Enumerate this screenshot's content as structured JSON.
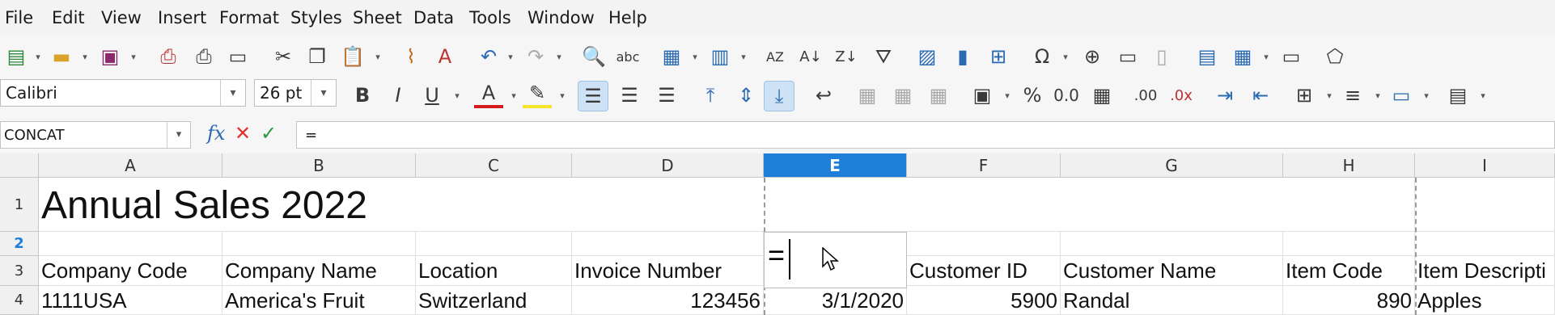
{
  "menu": [
    "File",
    "Edit",
    "View",
    "Insert",
    "Format",
    "Styles",
    "Sheet",
    "Data",
    "Tools",
    "Window",
    "Help"
  ],
  "toolbar2": {
    "font_name": "Calibri",
    "font_size": "26 pt"
  },
  "formula_bar": {
    "name_box": "CONCAT",
    "fx": "fx",
    "cancel": "✕",
    "accept": "✓",
    "content": "="
  },
  "columns": [
    "A",
    "B",
    "C",
    "D",
    "E",
    "F",
    "G",
    "H",
    "I"
  ],
  "selected_column": "E",
  "rows": [
    "1",
    "2",
    "3",
    "4"
  ],
  "selected_row": "2",
  "cells": {
    "A1": "Annual Sales 2022",
    "A3": "Company Code",
    "B3": "Company Name",
    "C3": "Location",
    "D3": "Invoice Number",
    "E3": "",
    "F3": "Customer ID",
    "G3": "Customer Name",
    "H3": "Item Code",
    "I3": "Item Descripti",
    "A4": "1111USA",
    "B4": "America's Fruit",
    "C4": "Switzerland",
    "D4": "123456",
    "E4": "3/1/2020",
    "F4": "5900",
    "G4": "Randal",
    "H4": "890",
    "I4": "Apples"
  },
  "editing_cell": {
    "ref": "E2",
    "content": "="
  },
  "colors": {
    "selection": "#1e7fd8",
    "header_bg": "#f0f0f0",
    "active_tool": "#cfe2f5"
  },
  "icons": {
    "toolbar1": [
      "new-icon",
      "open-icon",
      "save-icon",
      "export-pdf-icon",
      "print-icon",
      "print-preview-icon",
      "cut-icon",
      "copy-icon",
      "paste-icon",
      "clone-formatting-icon",
      "clear-formatting-icon",
      "undo-icon",
      "redo-icon",
      "find-replace-icon",
      "spelling-icon",
      "row-icon",
      "column-icon",
      "sort-icon",
      "sort-ascending-icon",
      "sort-descending-icon",
      "autofilter-icon",
      "image-icon",
      "chart-icon",
      "pivot-table-icon",
      "special-character-icon",
      "hyperlink-icon",
      "comment-icon",
      "header-footer-icon",
      "define-print-area-icon",
      "freeze-icon",
      "split-window-icon",
      "show-draw-functions-icon"
    ],
    "toolbar2": [
      "bold-icon",
      "italic-icon",
      "underline-icon",
      "font-color-icon",
      "highlight-icon",
      "align-left-icon",
      "align-center-icon",
      "align-right-icon",
      "align-top-icon",
      "align-middle-icon",
      "align-bottom-icon",
      "wrap-text-icon",
      "merge-center-icon",
      "merge-cells-icon",
      "unmerge-cells-icon",
      "currency-icon",
      "percent-icon",
      "number-format-icon",
      "date-icon",
      "add-decimal-icon",
      "delete-decimal-icon",
      "increase-indent-icon",
      "decrease-indent-icon",
      "borders-icon",
      "border-style-icon",
      "border-color-icon",
      "conditional-icon"
    ]
  }
}
